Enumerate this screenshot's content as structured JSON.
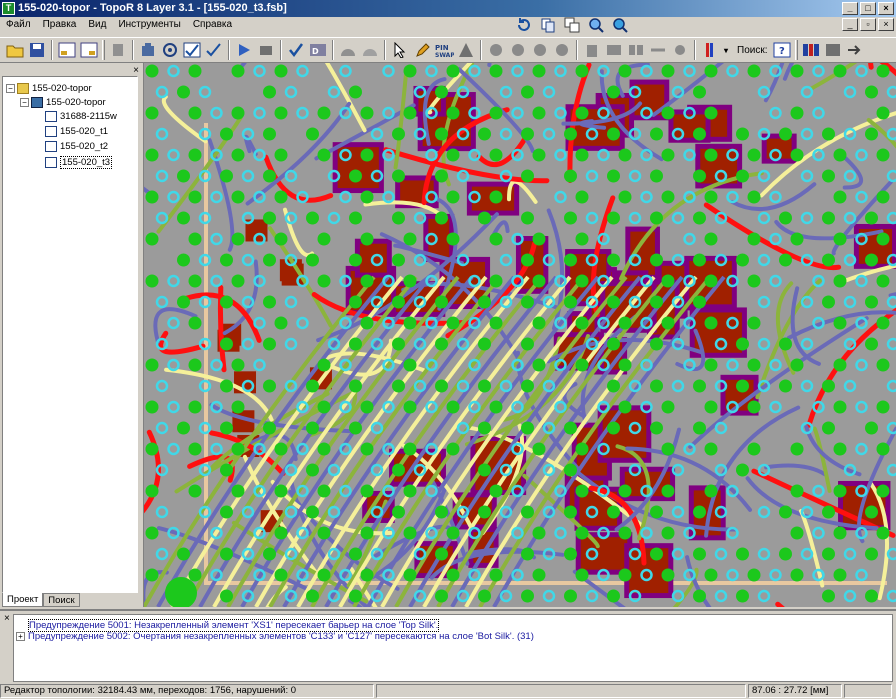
{
  "window": {
    "title": "155-020-topor - TopoR 8 Layer 3.1 - [155-020_t3.fsb]",
    "app_icon": "topor-app-icon",
    "controls": [
      "_",
      "□",
      "×"
    ]
  },
  "menu": {
    "items": [
      "Файл",
      "Правка",
      "Вид",
      "Инструменты",
      "Справка"
    ],
    "doc_controls": [
      "_",
      "▫",
      "×"
    ]
  },
  "toolbar": {
    "search_label": "Поиск:",
    "icons": [
      "open-folder-icon",
      "save-icon",
      "layer-view-icon",
      "layer-view-alt-icon",
      "stamp-icon",
      "trash-icon",
      "autoroute-icon",
      "route-check-icon",
      "route-check-alt-icon",
      "play-icon",
      "stop-icon",
      "checkmark-icon",
      "drc-icon",
      "arc-icon",
      "arc-alt-icon",
      "select-arrow-icon",
      "pen-icon",
      "pin-swap-icon",
      "warning-icon",
      "component-icon",
      "rotate-left-icon",
      "rotate-right-icon",
      "rotate-icon",
      "refresh-icon",
      "delete-icon",
      "align-icon",
      "split-icon",
      "wire-icon",
      "tone-icon",
      "dropdown-icon",
      "search-icon",
      "grid-icon",
      "panel-icon",
      "exit-icon"
    ]
  },
  "tree": {
    "root": "155-020-topor",
    "project": "155-020-topor",
    "items": [
      "31688-2115w",
      "155-020_t1",
      "155-020_t2",
      "155-020_t3"
    ],
    "selected": "155-020_t3"
  },
  "tabs": [
    "Проект",
    "Поиск"
  ],
  "messages": [
    "Предупреждение 5001: Незакрепленный элемент 'XS1' пересекает барьер на слое 'Top Silk'.",
    "Предупреждение 5002: Очертания незакрепленных элементов 'C133' и 'C127' пересекаются на  слое 'Bot Silk'.  (31)"
  ],
  "status": {
    "editor": "Редактор топологии: 32184.43 мм, переходов: 1756, нарушений: 0",
    "coords": "87.06 : 27.72 [мм]"
  },
  "colors": {
    "board": "#9b9b9b",
    "pad": "#a02000",
    "pad_border": "#800080",
    "trace_yellow": "#f5f09a",
    "trace_red": "#ff1010",
    "trace_purple": "#6a6ab8",
    "trace_green": "#8cb43c",
    "via_green": "#1cc81c",
    "via_cyan": "#40d8e8"
  }
}
